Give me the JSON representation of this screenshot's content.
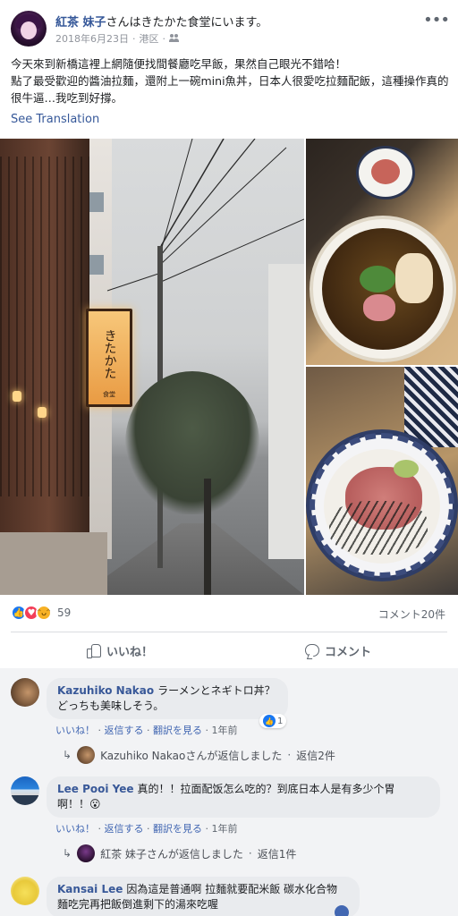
{
  "post": {
    "author": "紅茶 妹子",
    "checkin": "さんはきたかた食堂にいます。",
    "date": "2018年6月23日",
    "location": "港区",
    "separator": "·",
    "text_line1": "今天來到新橋這裡上網隨便找間餐廳吃早飯，果然自己眼光不錯哈！",
    "text_line2": "點了最受歡迎的醬油拉麵，還附上一碗mini魚丼，日本人很愛吃拉麵配飯，這種操作真的很牛逼…我吃到好撐。",
    "see_translation": "See Translation",
    "sign_main": "きたかた",
    "sign_sub": "食堂",
    "more_icon": "more-horizontal-icon"
  },
  "reactions": {
    "count": "59",
    "comments": "コメント20件",
    "types": [
      "like",
      "love",
      "haha"
    ]
  },
  "actions": {
    "like": "いいね！",
    "comment": "コメント"
  },
  "comments": [
    {
      "author": "Kazuhiko Nakao",
      "text_line1": "ラーメンとネギトロ丼？",
      "text_line2": "どっちも美味しそう。",
      "like": "いいね！",
      "reply": "返信する",
      "translate": "翻訳を見る",
      "time": "1年前",
      "likes": "1",
      "reply_summary": "Kazuhiko Nakaoさんが返信しました",
      "reply_count": "返信2件"
    },
    {
      "author": "Lee Pooi Yee",
      "text_line1": "真的！！拉面配饭怎么吃的？到底日本人是有多少个胃",
      "text_line2": "啊！！😮",
      "like": "いいね！",
      "reply": "返信する",
      "translate": "翻訳を見る",
      "time": "1年前",
      "reply_summary": "紅茶 妹子さんが返信しました",
      "reply_count": "返信1件"
    },
    {
      "author": "Kansai Lee",
      "text_line1": "因為這是普通啊 拉麵就要配米飯 碳水化合物",
      "text_line2": "麵吃完再把飯倒進剩下的湯來吃喔"
    }
  ],
  "dot": "·",
  "colors": {
    "link": "#365899",
    "meta": "#90949c",
    "like_blue": "#1877f2",
    "love_red": "#f33e58",
    "haha_yellow": "#f7b125"
  }
}
